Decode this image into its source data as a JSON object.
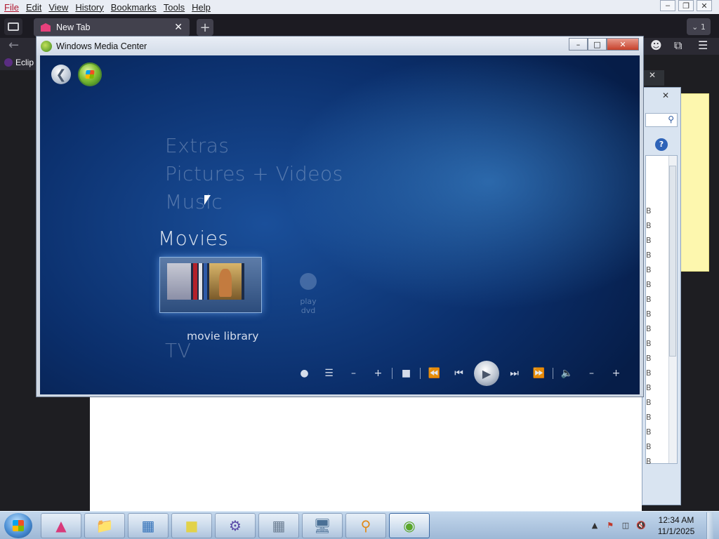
{
  "browser": {
    "menu": [
      "File",
      "Edit",
      "View",
      "History",
      "Bookmarks",
      "Tools",
      "Help"
    ],
    "tab": {
      "title": "New Tab"
    },
    "tab_count": "1",
    "bookmark": "Eclip"
  },
  "wmc": {
    "title": "Windows Media Center",
    "categories": {
      "extras": "Extras",
      "pictures": "Pictures + Videos",
      "music": "Music",
      "movies": "Movies",
      "tv": "TV"
    },
    "tiles": {
      "library_label": "movie library",
      "dvd_label": "play dvd"
    }
  },
  "dialog": {
    "rows": [
      "B",
      "B",
      "B",
      "B",
      "B",
      "B",
      "B",
      "B",
      "B",
      "B",
      "B",
      "B",
      "B",
      "B",
      "B",
      "B",
      "B",
      "B"
    ]
  },
  "taskbar": {
    "time": "12:34 AM",
    "date": "11/1/2025"
  }
}
